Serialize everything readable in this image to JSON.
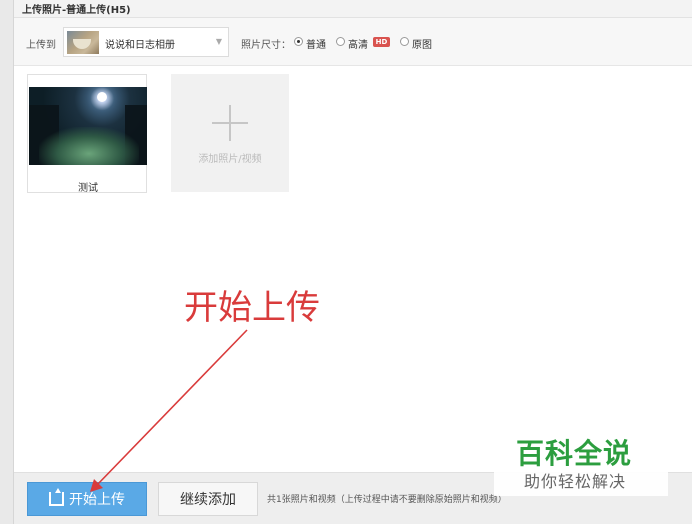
{
  "dialog": {
    "title": "上传照片-普通上传(H5)"
  },
  "toolbar": {
    "upload_to_label": "上传到",
    "album_name": "说说和日志相册",
    "album_caret": "▼",
    "size_label": "照片尺寸：",
    "size_options": [
      {
        "label": "普通",
        "checked": true
      },
      {
        "label": "高清",
        "checked": false
      },
      {
        "label": "原图",
        "checked": false
      }
    ],
    "hd_badge": "HD"
  },
  "photos": [
    {
      "caption": "测试"
    }
  ],
  "add_tile": {
    "label": "添加照片/视频"
  },
  "annotation": {
    "text": "开始上传",
    "color": "#d93b3b"
  },
  "footer": {
    "start_button": "开始上传",
    "continue_button": "继续添加",
    "note": "共1张照片和视频（上传过程中请不要删除原始照片和视频）"
  },
  "watermark": {
    "title": "百科全说",
    "subtitle": "助你轻松解决"
  },
  "colors": {
    "primary_button": "#5aa9e6",
    "watermark_green": "#2c9e3f",
    "hd_red": "#d9534f"
  }
}
